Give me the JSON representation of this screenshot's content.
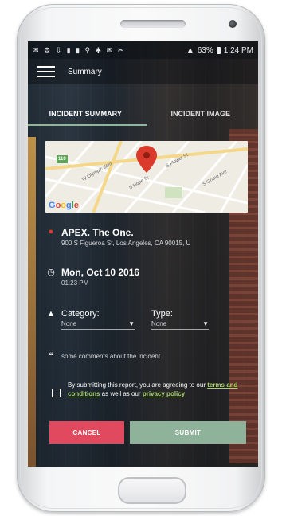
{
  "status_bar": {
    "left_icons": "✉ ⚙ ⇩ ▮ ▮ ⚲ ✱ ✉ ✂ ",
    "battery": "63%",
    "time": "1:24 PM"
  },
  "app_bar": {
    "title": "Summary",
    "menu_icon": "hamburger-menu"
  },
  "tabs": [
    {
      "label": "INCIDENT SUMMARY",
      "active": true
    },
    {
      "label": "INCIDENT IMAGE",
      "active": false
    }
  ],
  "map": {
    "google_logo": "Google",
    "route_badge": "110",
    "street_labels": [
      "W Olympic Blvd",
      "S Flower St",
      "S Grand Ave",
      "S Hope St"
    ]
  },
  "location": {
    "name": "APEX. The One.",
    "address": "900 S Figueroa St, Los Angeles, CA 90015, U"
  },
  "datetime": {
    "date": "Mon, Oct 10 2016",
    "time": "01:23 PM"
  },
  "category": {
    "label": "Category:",
    "value": "None"
  },
  "type": {
    "label": "Type:",
    "value": "None"
  },
  "comment": {
    "text": "some comments about the incident"
  },
  "consent": {
    "prefix": "By submitting this report, you are agreeing to our ",
    "terms_link": "terms and conditions",
    "middle": " as well as our ",
    "privacy_link": "privacy policy"
  },
  "buttons": {
    "cancel": "CANCEL",
    "submit": "SUBMIT"
  },
  "colors": {
    "cancel": "#e14a5e",
    "submit": "#8fb29b",
    "accent": "#8fb59a",
    "link": "#a9d06c",
    "pin": "#d93a2b"
  }
}
